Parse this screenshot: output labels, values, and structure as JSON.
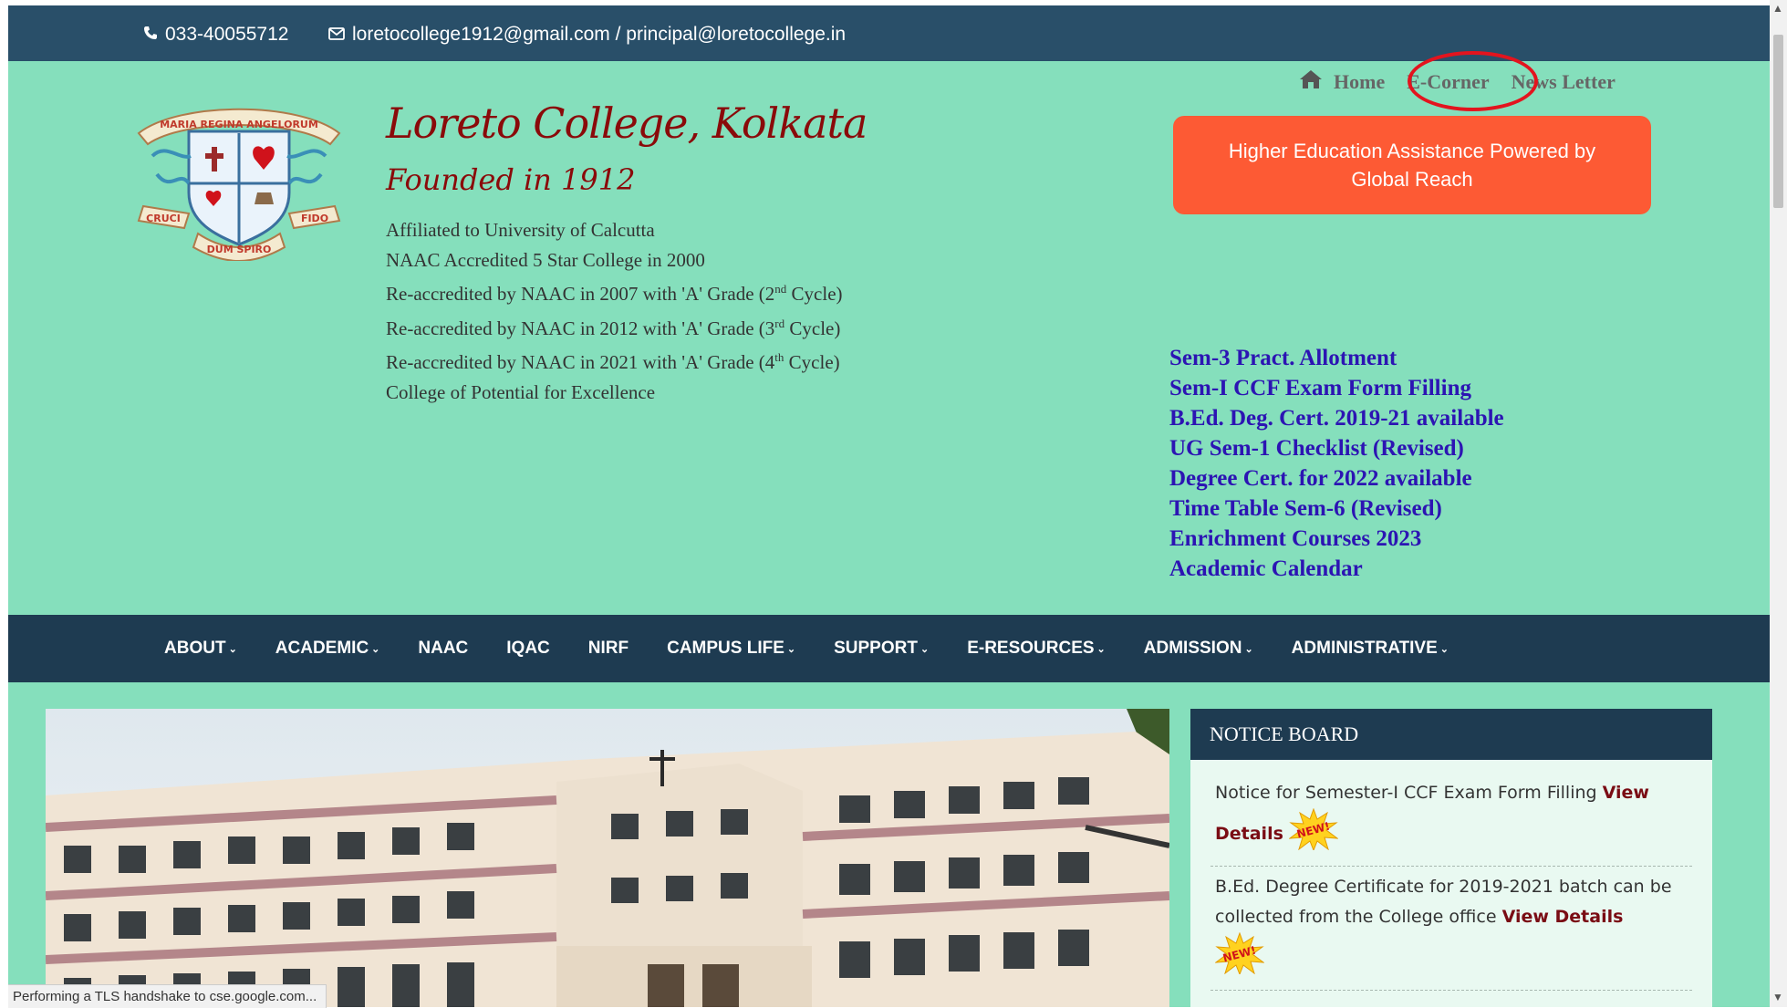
{
  "topbar": {
    "phone": "033-40055712",
    "email": "loretocollege1912@gmail.com / principal@loretocollege.in",
    "phone_icon": "phone-icon",
    "email_icon": "envelope-icon"
  },
  "quicklinks": {
    "home": "Home",
    "ecorner": "E-Corner",
    "newsletter": "News Letter",
    "home_icon": "home-icon"
  },
  "header": {
    "title": "Loreto College, Kolkata",
    "founded": "Founded in 1912",
    "logo_text": {
      "motto_top": "MARIA REGINA ANGELORUM",
      "left": "CRUCI",
      "right": "FIDO",
      "bottom": "DUM SPIRO"
    },
    "affiliations": {
      "l1": "Affiliated to University of Calcutta",
      "l2": "NAAC Accredited 5 Star College in 2000",
      "l3a": "Re-accredited by NAAC in 2007 with 'A' Grade (2",
      "l3sup": "nd",
      "l3b": " Cycle)",
      "l4a": "Re-accredited by NAAC in 2012 with 'A' Grade (3",
      "l4sup": "rd",
      "l4b": " Cycle)",
      "l5a": "Re-accredited by NAAC in 2021 with 'A' Grade (4",
      "l5sup": "th",
      "l5b": " Cycle)",
      "l6": "College of Potential for Excellence"
    }
  },
  "assist_button": "Higher Education Assistance Powered by Global Reach",
  "news_links": [
    "Sem-3 Pract. Allotment",
    "Sem-I CCF Exam Form Filling",
    "B.Ed. Deg. Cert. 2019-21 available",
    "UG Sem-1 Checklist (Revised)",
    "Degree Cert. for 2022 available",
    "Time Table Sem-6 (Revised)",
    "Enrichment Courses 2023",
    "Academic Calendar"
  ],
  "nav": [
    {
      "label": "ABOUT",
      "dropdown": true
    },
    {
      "label": "ACADEMIC",
      "dropdown": true
    },
    {
      "label": "NAAC",
      "dropdown": false
    },
    {
      "label": "IQAC",
      "dropdown": false
    },
    {
      "label": "NIRF",
      "dropdown": false
    },
    {
      "label": "CAMPUS LIFE",
      "dropdown": true
    },
    {
      "label": "SUPPORT",
      "dropdown": true
    },
    {
      "label": "E-RESOURCES",
      "dropdown": true
    },
    {
      "label": "ADMISSION",
      "dropdown": true
    },
    {
      "label": "ADMINISTRATIVE",
      "dropdown": true
    }
  ],
  "notice_board": {
    "title": "NOTICE BOARD",
    "items": [
      {
        "text": "Notice for Semester-I CCF Exam Form Filling ",
        "link": "View Details"
      },
      {
        "text": "B.Ed. Degree Certificate for 2019-2021 batch can be collected from the College office ",
        "link": "View Details"
      }
    ],
    "badge": "NEW!"
  },
  "status_bar": "Performing a TLS handshake to cse.google.com...",
  "colors": {
    "background": "#85dfbc",
    "topbar": "#294f69",
    "nav": "#1e3b51",
    "accent_button": "#fd5a34",
    "title": "#8a0a0a",
    "news_link": "#2c14b3",
    "annotation_circle": "#e3141e"
  }
}
